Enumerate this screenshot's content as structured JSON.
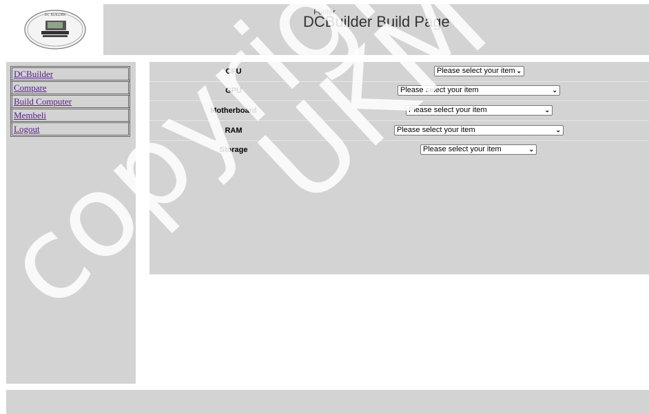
{
  "header": {
    "title": "DCBuilder Build Page",
    "logo_text": "DC BUILDER"
  },
  "nav": [
    {
      "label": "DCBuilder"
    },
    {
      "label": "Compare"
    },
    {
      "label": "Build Computer"
    },
    {
      "label": "Membeli"
    },
    {
      "label": "Logout"
    }
  ],
  "form": {
    "rows": [
      {
        "label": "CPU",
        "value": "Please select your item"
      },
      {
        "label": "GPU",
        "value": "Please select your item"
      },
      {
        "label": "Motherboard",
        "value": "Please select your item"
      },
      {
        "label": "RAM",
        "value": "Please select your item"
      },
      {
        "label": "Storage",
        "value": "Please select your item"
      }
    ]
  },
  "footer": {
    "text": "Footer"
  },
  "watermark": {
    "line1": "copyright",
    "line2": "UKM"
  }
}
